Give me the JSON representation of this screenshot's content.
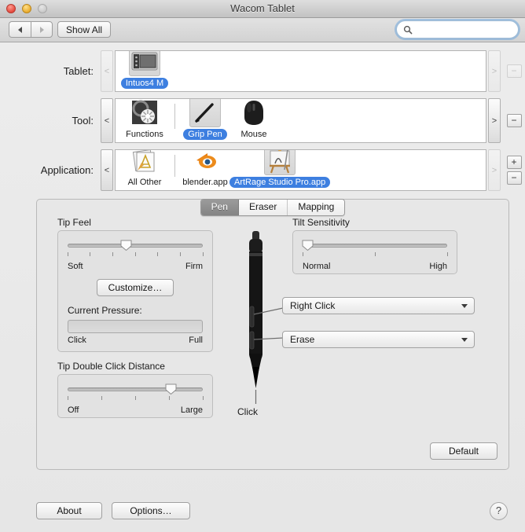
{
  "window": {
    "title": "Wacom Tablet",
    "traffic_lights": [
      "close-button",
      "minimize-button",
      "zoom-button"
    ]
  },
  "toolbar": {
    "back_icon": "triangle-left-icon",
    "forward_icon": "triangle-right-icon",
    "show_all_label": "Show All",
    "search": {
      "icon": "search-icon",
      "value": "",
      "placeholder": ""
    }
  },
  "rows": [
    {
      "label": "Tablet:",
      "prev_label": "<",
      "next_label": ">",
      "prev_enabled": false,
      "next_enabled": false,
      "items": [
        {
          "name": "Intuos4 M",
          "icon": "tablet-icon",
          "selected": true
        }
      ],
      "buttons": [
        {
          "label": "−",
          "name": "remove-tablet-button",
          "enabled": false
        }
      ]
    },
    {
      "label": "Tool:",
      "prev_label": "<",
      "next_label": ">",
      "prev_enabled": true,
      "next_enabled": true,
      "items": [
        {
          "name": "Functions",
          "icon": "functions-icon",
          "selected": false
        },
        {
          "name": "Grip Pen",
          "icon": "grip-pen-icon",
          "selected": true
        },
        {
          "name": "Mouse",
          "icon": "mouse-icon",
          "selected": false
        }
      ],
      "buttons": [
        {
          "label": "−",
          "name": "remove-tool-button",
          "enabled": true
        }
      ]
    },
    {
      "label": "Application:",
      "prev_label": "<",
      "next_label": ">",
      "prev_enabled": true,
      "next_enabled": false,
      "items": [
        {
          "name": "All Other",
          "icon": "all-other-icon",
          "selected": false
        },
        {
          "name": "blender.app",
          "icon": "blender-icon",
          "selected": false
        },
        {
          "name": "ArtRage Studio Pro.app",
          "icon": "artrage-icon",
          "selected": true
        }
      ],
      "buttons": [
        {
          "label": "+",
          "name": "add-application-button",
          "enabled": true
        },
        {
          "label": "−",
          "name": "remove-application-button",
          "enabled": true
        }
      ]
    }
  ],
  "tabs": [
    {
      "label": "Pen",
      "active": true
    },
    {
      "label": "Eraser",
      "active": false
    },
    {
      "label": "Mapping",
      "active": false
    }
  ],
  "pen_panel": {
    "tip_feel": {
      "title": "Tip Feel",
      "slider": {
        "min_label": "Soft",
        "max_label": "Firm",
        "value_pct": 43,
        "ticks": 7
      },
      "customize_label": "Customize…",
      "current_pressure_label": "Current Pressure:",
      "pressure_min_label": "Click",
      "pressure_max_label": "Full",
      "pressure_value_pct": 0
    },
    "tip_double_click_distance": {
      "title": "Tip Double Click Distance",
      "slider": {
        "min_label": "Off",
        "max_label": "Large",
        "value_pct": 76,
        "ticks": 5
      }
    },
    "tilt_sensitivity": {
      "title": "Tilt Sensitivity",
      "slider": {
        "min_label": "Normal",
        "max_label": "High",
        "value_pct": 3,
        "ticks": 3
      }
    },
    "pen_diagram": {
      "icon": "stylus-pen-icon",
      "tip_label": "Click"
    },
    "button_menus": [
      {
        "value": "Right Click",
        "arrow": "chevron-down-icon"
      },
      {
        "value": "Erase",
        "arrow": "chevron-down-icon"
      }
    ],
    "default_label": "Default"
  },
  "footer": {
    "about_label": "About",
    "options_label": "Options…",
    "help_label": "?",
    "help_icon": "question-mark-icon"
  },
  "colors": {
    "selection_blue": "#3d7fe0",
    "window_bg": "#ebebeb",
    "panel_bg": "#e7e7e7",
    "focus_ring": "#6ea5dc"
  }
}
